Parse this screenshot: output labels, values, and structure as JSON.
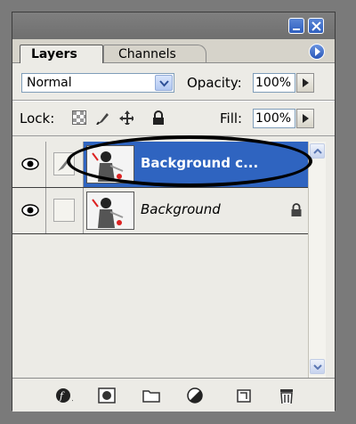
{
  "tabs": [
    {
      "label": "Layers",
      "active": true
    },
    {
      "label": "Channels",
      "active": false
    }
  ],
  "blend_mode": {
    "value": "Normal"
  },
  "opacity": {
    "label": "Opacity:",
    "value": "100%"
  },
  "lock": {
    "label": "Lock:"
  },
  "fill": {
    "label": "Fill:",
    "value": "100%"
  },
  "layers": [
    {
      "name": "Background c...",
      "selected": true,
      "locked": false
    },
    {
      "name": "Background",
      "selected": false,
      "locked": true
    }
  ],
  "colors": {
    "selection": "#2f64c0",
    "panel": "#ecebe6",
    "xp_button": "#2f5fbf",
    "annotation": "#000000"
  },
  "icons": {
    "bottom_bar": [
      "layer-style-icon",
      "layer-mask-icon",
      "new-group-icon",
      "adjustment-layer-icon",
      "new-layer-icon",
      "trash-icon"
    ]
  }
}
